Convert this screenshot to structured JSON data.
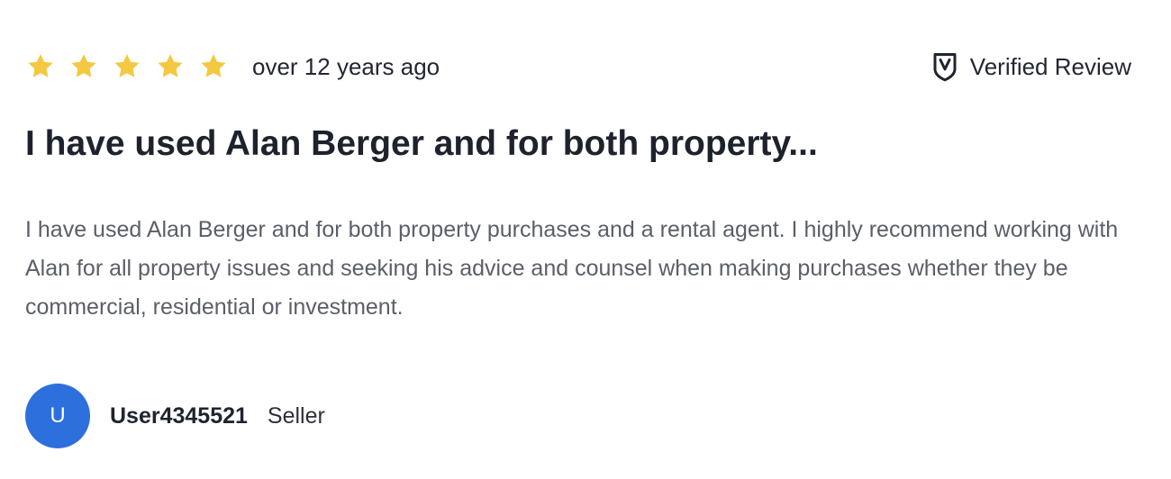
{
  "review": {
    "rating": 5,
    "max_rating": 5,
    "time": "over 12 years ago",
    "verified_label": "Verified Review",
    "title": "I have used Alan Berger and for both property...",
    "body": "I have used Alan Berger and for both property purchases and a rental agent. I highly recommend working with Alan for all property issues and seeking his advice and counsel when making purchases whether they be commercial, residential or investment."
  },
  "author": {
    "initial": "U",
    "name": "User4345521",
    "role": "Seller"
  },
  "colors": {
    "star": "#f5c842",
    "avatar": "#2d6fdc",
    "title": "#1d222d",
    "body": "#5b5f69"
  },
  "icons": {
    "rating": "star-icon",
    "verified": "verified-shield-icon"
  }
}
